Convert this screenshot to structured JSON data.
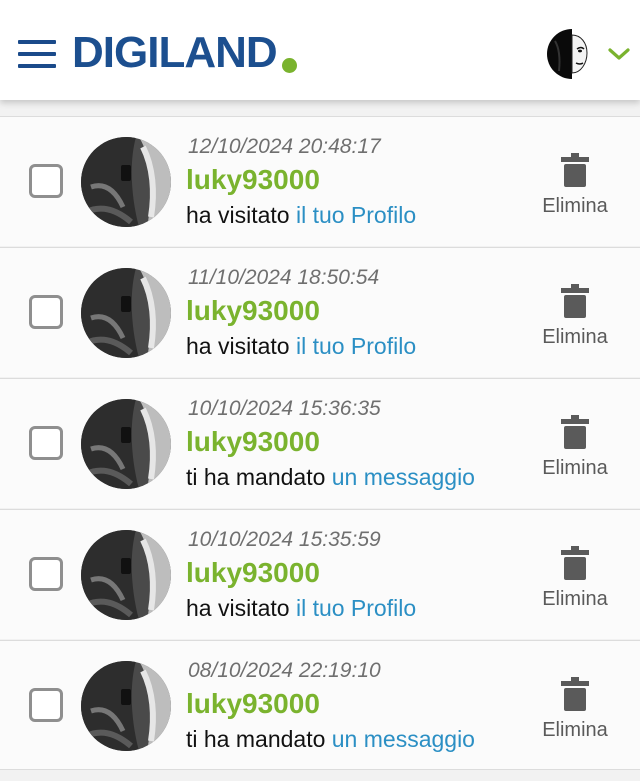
{
  "header": {
    "logo_text": "DIGILAND",
    "brand_color": "#1c4f8f",
    "accent_color": "#7ab32e"
  },
  "notifications": [
    {
      "timestamp": "12/10/2024 20:48:17",
      "user": "luky93000",
      "action_prefix": "ha visitato ",
      "action_link": "il tuo Profilo",
      "delete_label": "Elimina"
    },
    {
      "timestamp": "11/10/2024 18:50:54",
      "user": "luky93000",
      "action_prefix": "ha visitato ",
      "action_link": "il tuo Profilo",
      "delete_label": "Elimina"
    },
    {
      "timestamp": "10/10/2024 15:36:35",
      "user": "luky93000",
      "action_prefix": "ti ha mandato ",
      "action_link": "un messaggio",
      "delete_label": "Elimina"
    },
    {
      "timestamp": "10/10/2024 15:35:59",
      "user": "luky93000",
      "action_prefix": "ha visitato ",
      "action_link": "il tuo Profilo",
      "delete_label": "Elimina"
    },
    {
      "timestamp": "08/10/2024 22:19:10",
      "user": "luky93000",
      "action_prefix": "ti ha mandato ",
      "action_link": "un messaggio",
      "delete_label": "Elimina"
    }
  ],
  "colors": {
    "link": "#2b8fc4",
    "username": "#7ab32e",
    "timestamp": "#6f6f6f"
  }
}
